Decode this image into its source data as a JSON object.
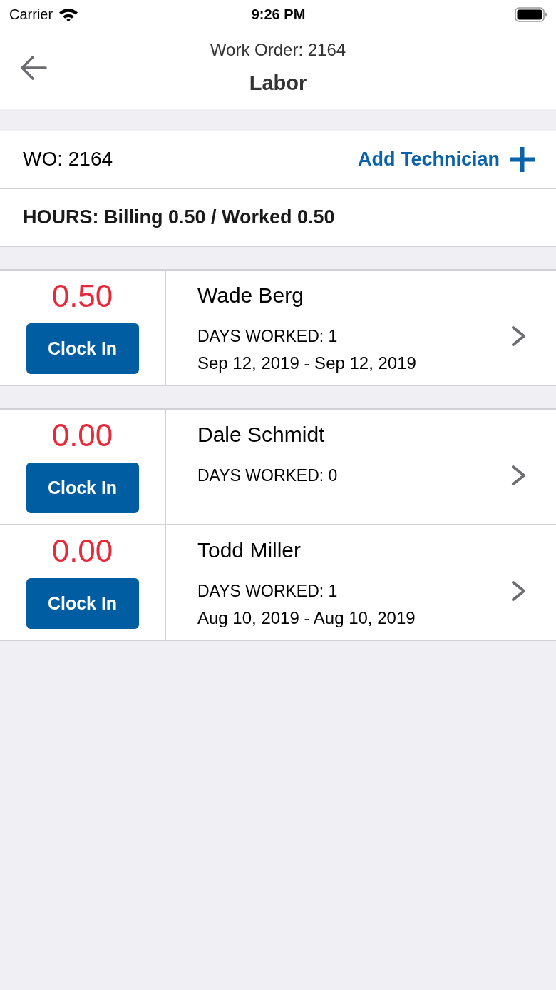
{
  "status_bar": {
    "carrier": "Carrier",
    "time": "9:26 PM"
  },
  "nav": {
    "subtitle": "Work Order: 2164",
    "title": "Labor"
  },
  "work_order": {
    "label": "WO: 2164",
    "action": "Add Technician"
  },
  "hours": {
    "text": "HOURS: Billing 0.50 / Worked 0.50"
  },
  "groups": [
    {
      "technicians": [
        {
          "hours": "0.50",
          "button": "Clock In",
          "name": "Wade Berg",
          "days_worked": "DAYS WORKED: 1",
          "date_range": "Sep 12, 2019 - Sep 12, 2019"
        }
      ]
    },
    {
      "technicians": [
        {
          "hours": "0.00",
          "button": "Clock In",
          "name": "Dale Schmidt",
          "days_worked": "DAYS WORKED: 0"
        },
        {
          "hours": "0.00",
          "button": "Clock In",
          "name": "Todd Miller",
          "days_worked": "DAYS WORKED: 1",
          "date_range": "Aug 10, 2019 - Aug 10, 2019"
        }
      ]
    }
  ]
}
